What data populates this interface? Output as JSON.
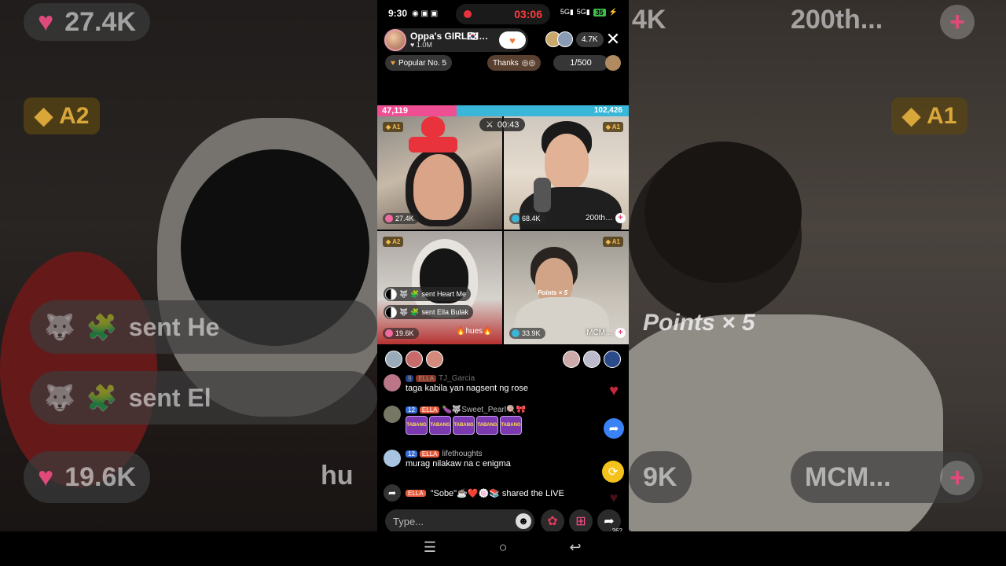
{
  "status": {
    "time": "9:30",
    "rec_time": "03:06",
    "battery": "35"
  },
  "host": {
    "name": "Oppa's GIRL🇰🇷…",
    "likes": "1.0M"
  },
  "viewers": {
    "count": "4.7K"
  },
  "tags": {
    "popular": "Popular No. 5",
    "thanks": "Thanks",
    "rank_count": "1/500"
  },
  "battle": {
    "left_score": "47,119",
    "right_score": "102,426",
    "left_fraction": 0.315,
    "timer": "00:43"
  },
  "tiles": [
    {
      "rank": "A1",
      "score": "27.4K",
      "name": "",
      "score_color": "#f06aa0"
    },
    {
      "rank": "A1",
      "score": "68.4K",
      "name": "200th…",
      "score_color": "#39b6d8"
    },
    {
      "rank": "A2",
      "score": "19.6K",
      "name": "",
      "score_color": "#f06aa0"
    },
    {
      "rank": "A1",
      "score": "33.9K",
      "name": "MCM…",
      "score_color": "#39b6d8"
    }
  ],
  "gifts": {
    "line1": "sent Heart Me",
    "line2": "sent Ella Bulak",
    "points": "Points × 5",
    "hues": "🔥hues🔥"
  },
  "chat": [
    {
      "level": "9",
      "club": "ELLA",
      "user": "TJ_Garcia",
      "text": "taga kabila yan nagsent ng rose"
    },
    {
      "level": "12",
      "club": "ELLA",
      "user": "🍆🐺Sweet_Pearl🍭🎀",
      "text": "",
      "stickers": [
        "TABANG",
        "TABANG",
        "TABANG",
        "TABANG",
        "TABANG"
      ]
    },
    {
      "level": "12",
      "club": "ELLA",
      "user": "lifethoughts",
      "text": "murag nilakaw na c enigma"
    }
  ],
  "share": {
    "club": "ELLA",
    "text": "\"Sobe\"☕❤️🍥📚 shared the LIVE"
  },
  "input": {
    "placeholder": "Type..."
  },
  "actions": {
    "share_count": "262"
  },
  "background": {
    "left_score": "27.4K",
    "left_rank": "A2",
    "left_gift": "sent He",
    "left_gift2": "sent El",
    "left_score2": "19.6K",
    "left_hues": "hu",
    "right_score": "200th...",
    "right_top": "4K",
    "right_rank": "A1",
    "right_points": "Points × 5",
    "right_name": "MCM...",
    "right_score2": "9K"
  }
}
